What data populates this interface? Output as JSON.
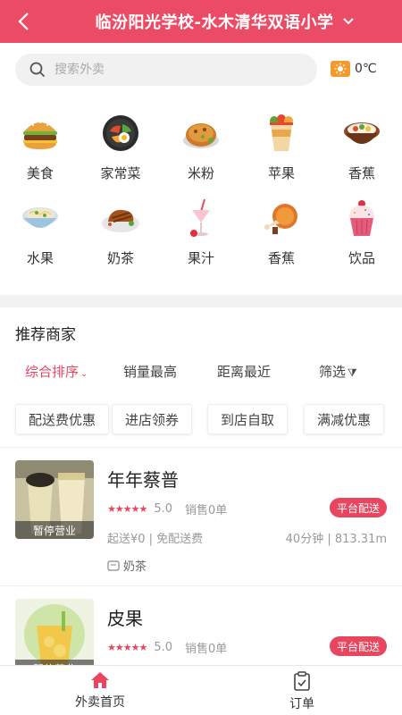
{
  "header": {
    "title": "临汾阳光学校-水木清华双语小学",
    "back_icon": "chevron-left-icon",
    "dropdown_icon": "chevron-down-icon"
  },
  "search": {
    "placeholder": "搜索外卖"
  },
  "weather": {
    "icon": "sun-icon",
    "temp": "0℃"
  },
  "categories": [
    {
      "label": "美食",
      "icon": "burger-icon"
    },
    {
      "label": "家常菜",
      "icon": "bibimbap-icon"
    },
    {
      "label": "米粉",
      "icon": "pancake-icon"
    },
    {
      "label": "苹果",
      "icon": "bubble-tea-cup-icon"
    },
    {
      "label": "香蕉",
      "icon": "rice-bowl-icon"
    },
    {
      "label": "水果",
      "icon": "noodle-bowl-icon"
    },
    {
      "label": "奶茶",
      "icon": "grilled-meat-icon"
    },
    {
      "label": "果汁",
      "icon": "smoothie-icon"
    },
    {
      "label": "香蕉",
      "icon": "roast-chicken-icon"
    },
    {
      "label": "饮品",
      "icon": "cupcake-icon"
    }
  ],
  "section_title": "推荐商家",
  "sort_options": [
    {
      "label": "综合排序",
      "active": true
    },
    {
      "label": "销量最高",
      "active": false
    },
    {
      "label": "距离最近",
      "active": false
    },
    {
      "label": "筛选",
      "active": false
    }
  ],
  "filter_tags": [
    "配送费优惠",
    "进店领券",
    "到店自取",
    "满减优惠"
  ],
  "stores": [
    {
      "name": "年年蔡普",
      "status": "暂停营业",
      "rating": "5.0",
      "sales": "销售0单",
      "badge": "平台配送",
      "fees": "起送¥0 | 免配送费",
      "eta_distance": "40分钟 | 813.31m",
      "category": "奶茶"
    },
    {
      "name": "皮果",
      "status": "暂停营业",
      "rating": "5.0",
      "sales": "销售0单",
      "badge": "平台配送"
    }
  ],
  "bottom_nav": [
    {
      "label": "外卖首页",
      "icon": "home-icon",
      "active": true
    },
    {
      "label": "订单",
      "icon": "order-list-icon",
      "active": false
    }
  ],
  "colors": {
    "brand": "#ec4b65",
    "accent_text": "#e24560",
    "badge": "#e8465f"
  }
}
